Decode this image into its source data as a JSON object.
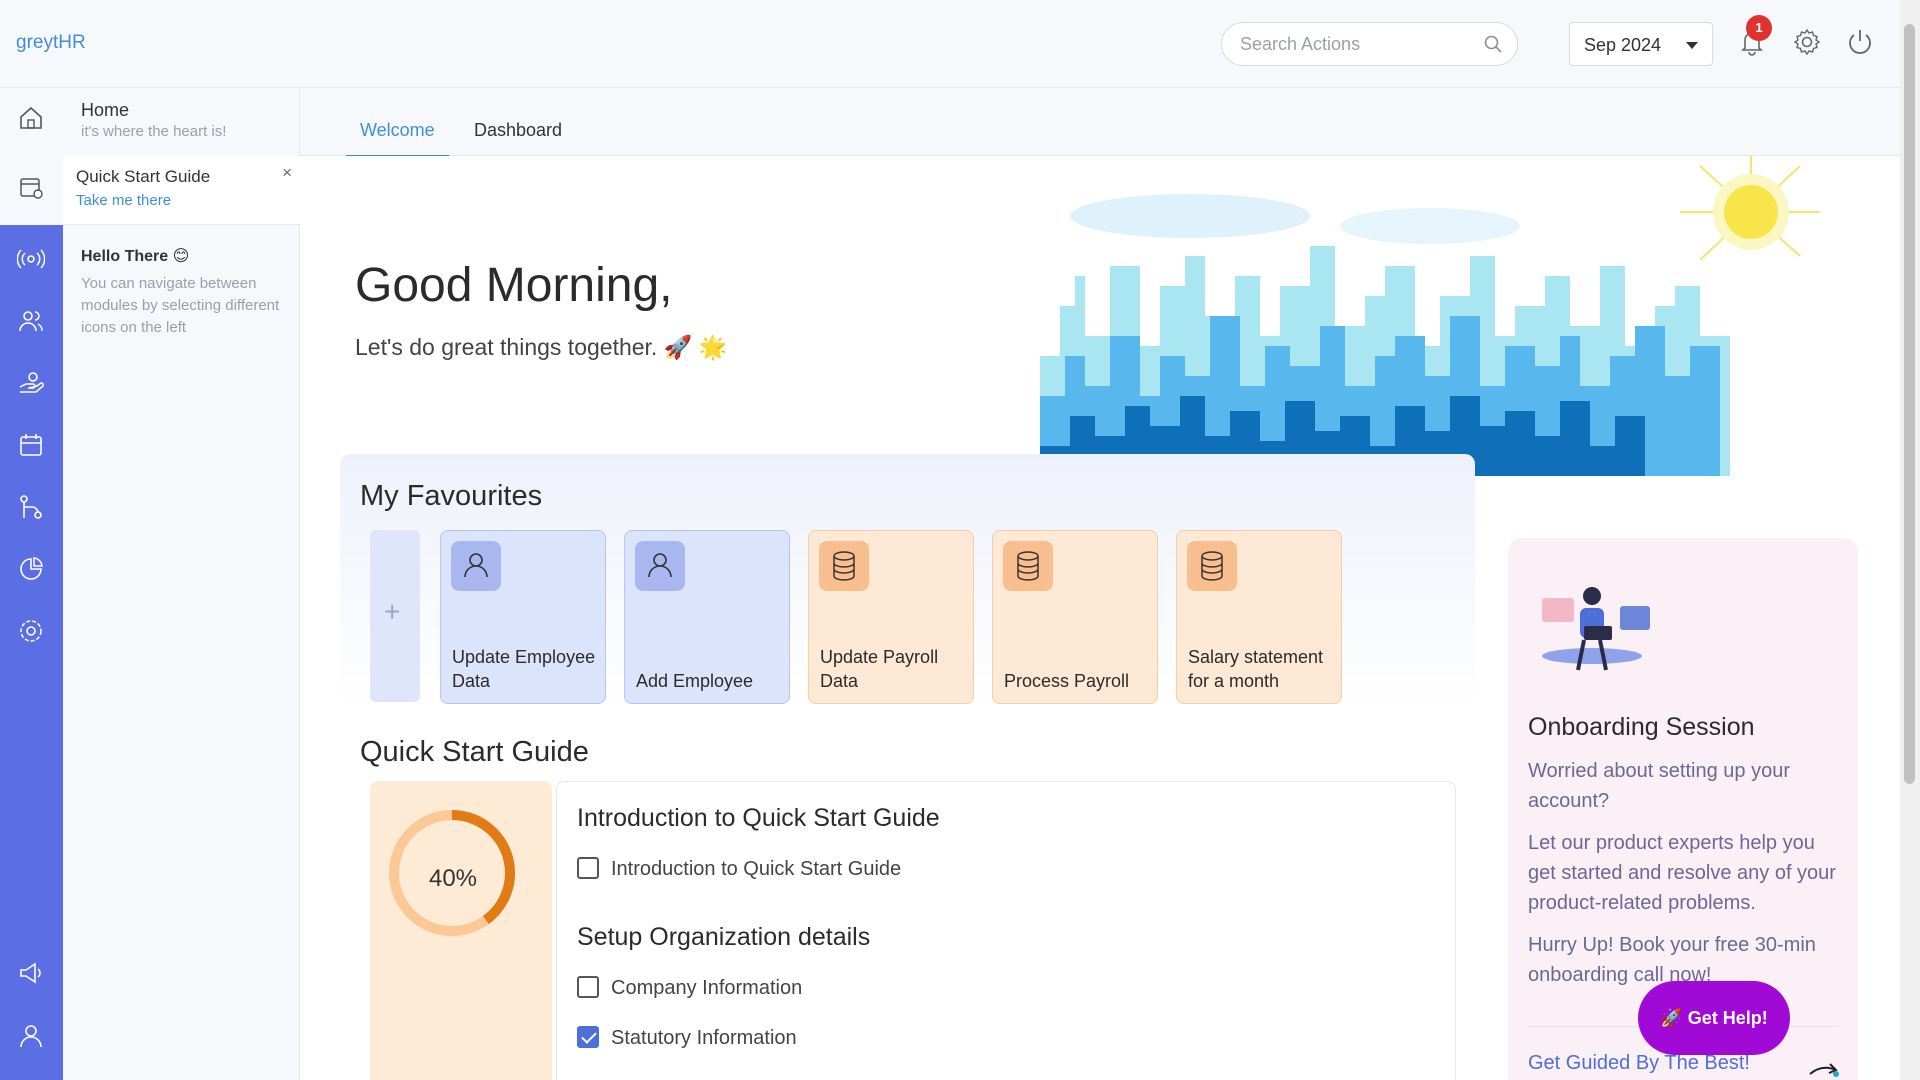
{
  "header": {
    "logo": "greytHR",
    "search_placeholder": "Search Actions",
    "month": "Sep 2024",
    "notification_count": "1"
  },
  "sidebar": {
    "home_title": "Home",
    "home_subtitle": "it's where the heart is!",
    "quick_start_title": "Quick Start Guide",
    "quick_start_link": "Take me there",
    "close": "×",
    "hello_title": "Hello There 😊",
    "hello_desc": "You can navigate between modules by selecting different icons on the left"
  },
  "tabs": [
    {
      "label": "Welcome",
      "active": true
    },
    {
      "label": "Dashboard",
      "active": false
    }
  ],
  "hero": {
    "greeting": "Good Morning,",
    "tagline": "Let's do great things together. 🚀 🌟"
  },
  "favourites": {
    "title": "My Favourites",
    "add": "+",
    "cards": [
      {
        "label": "Update Employee Data",
        "kind": "blue",
        "icon": "user-icon"
      },
      {
        "label": "Add Employee",
        "kind": "blue",
        "icon": "user-icon"
      },
      {
        "label": "Update Payroll Data",
        "kind": "orange",
        "icon": "database-icon"
      },
      {
        "label": "Process Payroll",
        "kind": "orange",
        "icon": "database-icon"
      },
      {
        "label": "Salary statement for a month",
        "kind": "orange",
        "icon": "database-icon"
      }
    ]
  },
  "quick_start": {
    "title": "Quick Start Guide",
    "progress_label": "40%",
    "progress": 0.4,
    "sections": [
      {
        "heading": "Introduction to Quick Start Guide",
        "items": [
          {
            "label": "Introduction to Quick Start Guide",
            "checked": false
          }
        ]
      },
      {
        "heading": "Setup Organization details",
        "items": [
          {
            "label": "Company Information",
            "checked": false
          },
          {
            "label": "Statutory Information",
            "checked": true
          }
        ]
      }
    ]
  },
  "onboarding": {
    "title": "Onboarding Session",
    "p1": "Worried about setting up your account?",
    "p2": "Let our product experts help you get started and resolve any of your product-related problems.",
    "p3": "Hurry Up! Book your free 30-min onboarding call now!",
    "link": "Get Guided By The Best!"
  },
  "help_button": "🚀 Get Help!",
  "colors": {
    "rail": "#5b6ee4",
    "accent": "#3f8fd6",
    "help": "#a109d6",
    "badge": "#e0322f"
  }
}
